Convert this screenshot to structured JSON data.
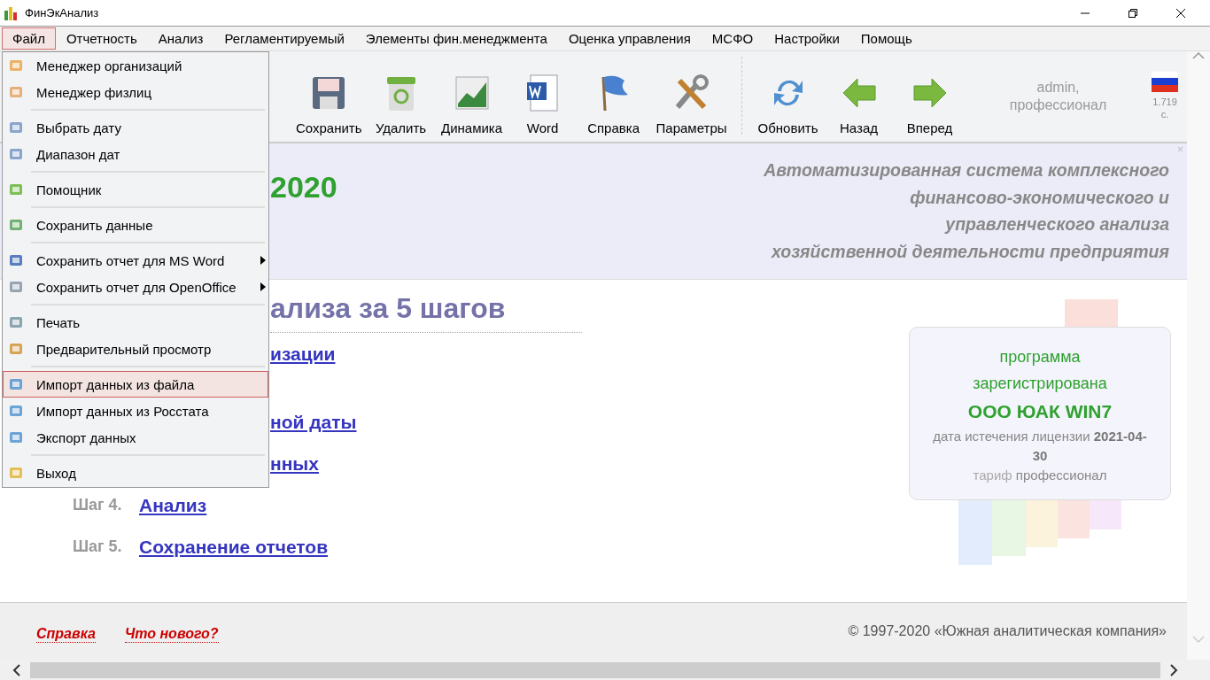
{
  "window": {
    "title": "ФинЭкАнализ"
  },
  "menu_bar": [
    {
      "label": "Файл",
      "selected": true
    },
    {
      "label": "Отчетность",
      "selected": false
    },
    {
      "label": "Анализ",
      "selected": false
    },
    {
      "label": "Регламентируемый",
      "selected": false
    },
    {
      "label": "Элементы фин.менеджмента",
      "selected": false
    },
    {
      "label": "Оценка управления",
      "selected": false
    },
    {
      "label": "МСФО",
      "selected": false
    },
    {
      "label": "Настройки",
      "selected": false
    },
    {
      "label": "Помощь",
      "selected": false
    }
  ],
  "file_menu": [
    {
      "kind": "item",
      "label": "Менеджер организаций",
      "selected": false,
      "submenu": false
    },
    {
      "kind": "item",
      "label": "Менеджер физлиц",
      "selected": false,
      "submenu": false
    },
    {
      "kind": "separator"
    },
    {
      "kind": "item",
      "label": "Выбрать дату",
      "selected": false,
      "submenu": false
    },
    {
      "kind": "item",
      "label": "Диапазон дат",
      "selected": false,
      "submenu": false
    },
    {
      "kind": "separator"
    },
    {
      "kind": "item",
      "label": "Помощник",
      "selected": false,
      "submenu": false
    },
    {
      "kind": "separator"
    },
    {
      "kind": "item",
      "label": "Сохранить данные",
      "selected": false,
      "submenu": false
    },
    {
      "kind": "separator"
    },
    {
      "kind": "item",
      "label": "Сохранить отчет для MS Word",
      "selected": false,
      "submenu": true
    },
    {
      "kind": "item",
      "label": "Сохранить отчет для OpenOffice",
      "selected": false,
      "submenu": true
    },
    {
      "kind": "separator"
    },
    {
      "kind": "item",
      "label": "Печать",
      "selected": false,
      "submenu": false
    },
    {
      "kind": "item",
      "label": "Предварительный просмотр",
      "selected": false,
      "submenu": false
    },
    {
      "kind": "separator"
    },
    {
      "kind": "item",
      "label": "Импорт данных из файла",
      "selected": true,
      "submenu": false
    },
    {
      "kind": "item",
      "label": "Импорт данных из Росстата",
      "selected": false,
      "submenu": false
    },
    {
      "kind": "item",
      "label": "Экспорт данных",
      "selected": false,
      "submenu": false
    },
    {
      "kind": "separator"
    },
    {
      "kind": "item",
      "label": "Выход",
      "selected": false,
      "submenu": false
    }
  ],
  "toolbar": [
    {
      "kind": "button",
      "label": "Сохранить"
    },
    {
      "kind": "button",
      "label": "Удалить"
    },
    {
      "kind": "button",
      "label": "Динамика"
    },
    {
      "kind": "button",
      "label": "Word"
    },
    {
      "kind": "button",
      "label": "Справка"
    },
    {
      "kind": "button",
      "label": "Параметры"
    },
    {
      "kind": "separator"
    },
    {
      "kind": "button",
      "label": "Обновить"
    },
    {
      "kind": "button",
      "label": "Назад"
    },
    {
      "kind": "button",
      "label": "Вперед"
    }
  ],
  "user": {
    "line_1": "admin,",
    "line_2": "профессионал"
  },
  "timing": {
    "line_1": "1.719",
    "line_2": "с."
  },
  "banner": {
    "year": "2020",
    "close": "×",
    "tagline": [
      "Автоматизированная система комплексного",
      "финансово-экономического и",
      "управленческого анализа",
      "хозяйственной деятельности предприятия"
    ]
  },
  "heading": "ализа за 5 шагов",
  "steps": [
    {
      "link": "изации"
    },
    {
      "link": "ной даты"
    },
    {
      "link": "нных"
    },
    {
      "label": "Шаг 4.",
      "link": "Анализ"
    },
    {
      "label": "Шаг 5.",
      "link": "Сохранение отчетов"
    }
  ],
  "license": {
    "line_1": "программа",
    "line_2": "зарегистрирована",
    "company": "ООО ЮАК WIN7",
    "expiry": "дата истечения лицензии **2021-04-30**",
    "tariff_label": "тариф",
    "tariff": "профессионал"
  },
  "footer": {
    "links": [
      "Справка",
      "Что нового?"
    ],
    "copyright": "© 1997-2020 «Южная аналитическая компания»"
  }
}
